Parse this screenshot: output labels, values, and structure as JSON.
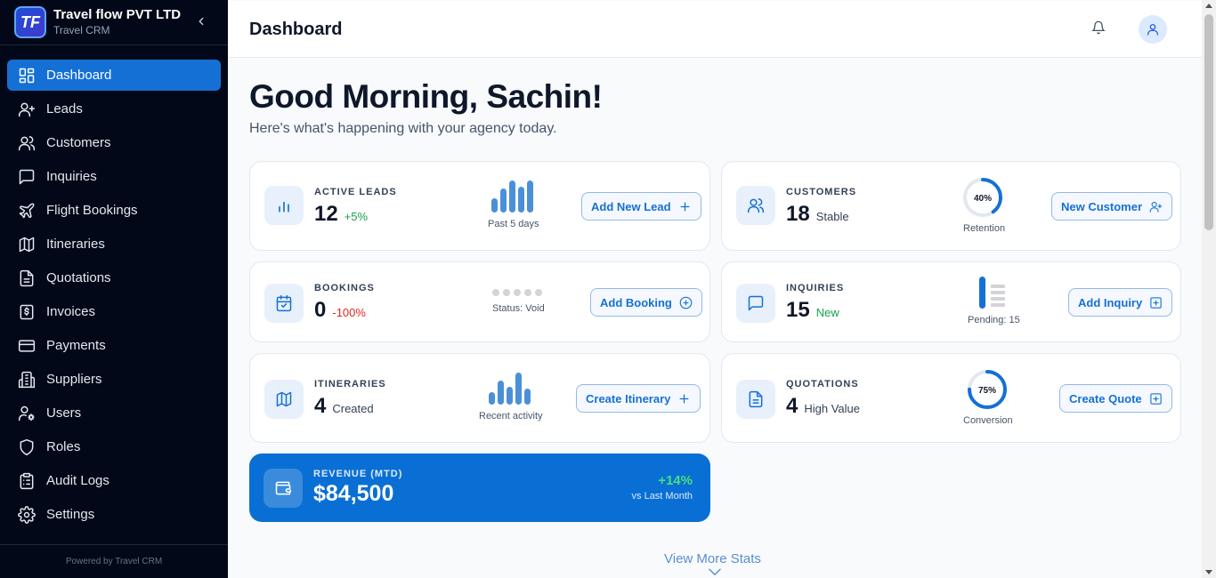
{
  "brand": {
    "logo_text": "TF",
    "name": "Travel flow PVT LTD",
    "subtitle": "Travel CRM"
  },
  "sidebar": {
    "items": [
      {
        "label": "Dashboard",
        "icon": "dashboard-icon",
        "active": true
      },
      {
        "label": "Leads",
        "icon": "user-plus-icon"
      },
      {
        "label": "Customers",
        "icon": "users-icon"
      },
      {
        "label": "Inquiries",
        "icon": "message-square-icon"
      },
      {
        "label": "Flight Bookings",
        "icon": "plane-icon"
      },
      {
        "label": "Itineraries",
        "icon": "map-icon"
      },
      {
        "label": "Quotations",
        "icon": "file-text-icon"
      },
      {
        "label": "Invoices",
        "icon": "receipt-dollar-icon"
      },
      {
        "label": "Payments",
        "icon": "credit-card-icon"
      },
      {
        "label": "Suppliers",
        "icon": "building-icon"
      },
      {
        "label": "Users",
        "icon": "user-cog-icon"
      },
      {
        "label": "Roles",
        "icon": "shield-icon"
      },
      {
        "label": "Audit Logs",
        "icon": "clipboard-list-icon"
      },
      {
        "label": "Settings",
        "icon": "gear-icon"
      }
    ],
    "footer": "Powered by Travel CRM"
  },
  "header": {
    "title": "Dashboard"
  },
  "main": {
    "greeting": "Good Morning, Sachin!",
    "subgreeting": "Here's what's happening with your agency today.",
    "cards": {
      "active_leads": {
        "label": "ACTIVE LEADS",
        "value": "12",
        "sub": "+5%",
        "caption": "Past 5 days",
        "button": "Add New Lead",
        "bars": [
          0.45,
          0.75,
          1.0,
          0.8,
          1.0
        ]
      },
      "customers": {
        "label": "CUSTOMERS",
        "value": "18",
        "sub": "Stable",
        "ring_text": "40%",
        "ring_fraction": 0.4,
        "caption": "Retention",
        "button": "New Customer"
      },
      "bookings": {
        "label": "BOOKINGS",
        "value": "0",
        "sub": "-100%",
        "caption": "Status: Void",
        "button": "Add Booking"
      },
      "inquiries": {
        "label": "INQUIRIES",
        "value": "15",
        "sub": "New",
        "caption": "Pending: 15",
        "button": "Add Inquiry"
      },
      "itineraries": {
        "label": "ITINERARIES",
        "value": "4",
        "sub": "Created",
        "caption": "Recent activity",
        "button": "Create Itinerary",
        "bars": [
          0.4,
          0.75,
          0.55,
          1.0,
          0.5
        ]
      },
      "quotations": {
        "label": "QUOTATIONS",
        "value": "4",
        "sub": "High Value",
        "ring_text": "75%",
        "ring_fraction": 0.75,
        "caption": "Conversion",
        "button": "Create Quote"
      }
    },
    "revenue": {
      "label": "REVENUE (MTD)",
      "value": "$84,500",
      "change": "+14%",
      "compare": "vs Last Month"
    },
    "view_more": "View More Stats"
  },
  "colors": {
    "accent": "#1570d6",
    "sidebar_bg": "#020817",
    "positive": "#16a34a",
    "negative": "#dc2626",
    "revenue_bg": "#0a6fd4"
  }
}
